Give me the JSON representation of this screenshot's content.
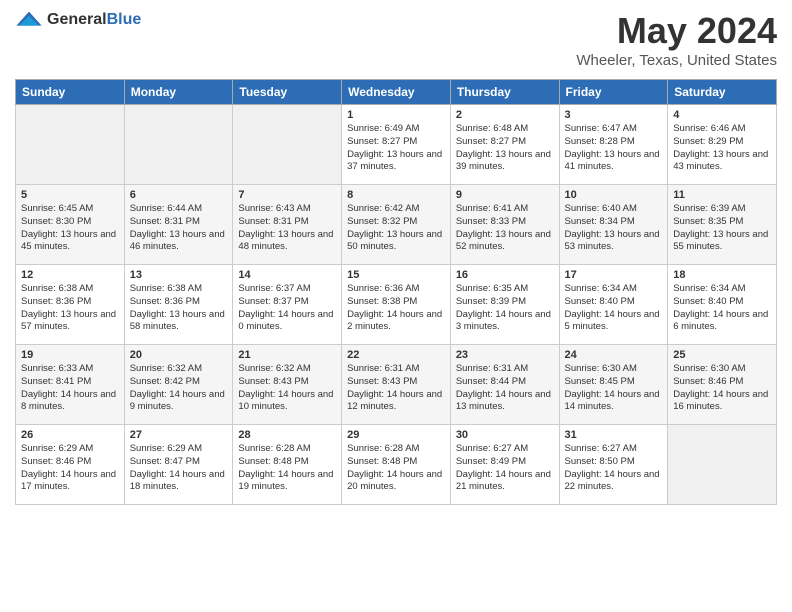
{
  "header": {
    "logo_general": "General",
    "logo_blue": "Blue",
    "month_year": "May 2024",
    "location": "Wheeler, Texas, United States"
  },
  "days_of_week": [
    "Sunday",
    "Monday",
    "Tuesday",
    "Wednesday",
    "Thursday",
    "Friday",
    "Saturday"
  ],
  "weeks": [
    [
      {
        "day": "",
        "info": ""
      },
      {
        "day": "",
        "info": ""
      },
      {
        "day": "",
        "info": ""
      },
      {
        "day": "1",
        "info": "Sunrise: 6:49 AM\nSunset: 8:27 PM\nDaylight: 13 hours and 37 minutes."
      },
      {
        "day": "2",
        "info": "Sunrise: 6:48 AM\nSunset: 8:27 PM\nDaylight: 13 hours and 39 minutes."
      },
      {
        "day": "3",
        "info": "Sunrise: 6:47 AM\nSunset: 8:28 PM\nDaylight: 13 hours and 41 minutes."
      },
      {
        "day": "4",
        "info": "Sunrise: 6:46 AM\nSunset: 8:29 PM\nDaylight: 13 hours and 43 minutes."
      }
    ],
    [
      {
        "day": "5",
        "info": "Sunrise: 6:45 AM\nSunset: 8:30 PM\nDaylight: 13 hours and 45 minutes."
      },
      {
        "day": "6",
        "info": "Sunrise: 6:44 AM\nSunset: 8:31 PM\nDaylight: 13 hours and 46 minutes."
      },
      {
        "day": "7",
        "info": "Sunrise: 6:43 AM\nSunset: 8:31 PM\nDaylight: 13 hours and 48 minutes."
      },
      {
        "day": "8",
        "info": "Sunrise: 6:42 AM\nSunset: 8:32 PM\nDaylight: 13 hours and 50 minutes."
      },
      {
        "day": "9",
        "info": "Sunrise: 6:41 AM\nSunset: 8:33 PM\nDaylight: 13 hours and 52 minutes."
      },
      {
        "day": "10",
        "info": "Sunrise: 6:40 AM\nSunset: 8:34 PM\nDaylight: 13 hours and 53 minutes."
      },
      {
        "day": "11",
        "info": "Sunrise: 6:39 AM\nSunset: 8:35 PM\nDaylight: 13 hours and 55 minutes."
      }
    ],
    [
      {
        "day": "12",
        "info": "Sunrise: 6:38 AM\nSunset: 8:36 PM\nDaylight: 13 hours and 57 minutes."
      },
      {
        "day": "13",
        "info": "Sunrise: 6:38 AM\nSunset: 8:36 PM\nDaylight: 13 hours and 58 minutes."
      },
      {
        "day": "14",
        "info": "Sunrise: 6:37 AM\nSunset: 8:37 PM\nDaylight: 14 hours and 0 minutes."
      },
      {
        "day": "15",
        "info": "Sunrise: 6:36 AM\nSunset: 8:38 PM\nDaylight: 14 hours and 2 minutes."
      },
      {
        "day": "16",
        "info": "Sunrise: 6:35 AM\nSunset: 8:39 PM\nDaylight: 14 hours and 3 minutes."
      },
      {
        "day": "17",
        "info": "Sunrise: 6:34 AM\nSunset: 8:40 PM\nDaylight: 14 hours and 5 minutes."
      },
      {
        "day": "18",
        "info": "Sunrise: 6:34 AM\nSunset: 8:40 PM\nDaylight: 14 hours and 6 minutes."
      }
    ],
    [
      {
        "day": "19",
        "info": "Sunrise: 6:33 AM\nSunset: 8:41 PM\nDaylight: 14 hours and 8 minutes."
      },
      {
        "day": "20",
        "info": "Sunrise: 6:32 AM\nSunset: 8:42 PM\nDaylight: 14 hours and 9 minutes."
      },
      {
        "day": "21",
        "info": "Sunrise: 6:32 AM\nSunset: 8:43 PM\nDaylight: 14 hours and 10 minutes."
      },
      {
        "day": "22",
        "info": "Sunrise: 6:31 AM\nSunset: 8:43 PM\nDaylight: 14 hours and 12 minutes."
      },
      {
        "day": "23",
        "info": "Sunrise: 6:31 AM\nSunset: 8:44 PM\nDaylight: 14 hours and 13 minutes."
      },
      {
        "day": "24",
        "info": "Sunrise: 6:30 AM\nSunset: 8:45 PM\nDaylight: 14 hours and 14 minutes."
      },
      {
        "day": "25",
        "info": "Sunrise: 6:30 AM\nSunset: 8:46 PM\nDaylight: 14 hours and 16 minutes."
      }
    ],
    [
      {
        "day": "26",
        "info": "Sunrise: 6:29 AM\nSunset: 8:46 PM\nDaylight: 14 hours and 17 minutes."
      },
      {
        "day": "27",
        "info": "Sunrise: 6:29 AM\nSunset: 8:47 PM\nDaylight: 14 hours and 18 minutes."
      },
      {
        "day": "28",
        "info": "Sunrise: 6:28 AM\nSunset: 8:48 PM\nDaylight: 14 hours and 19 minutes."
      },
      {
        "day": "29",
        "info": "Sunrise: 6:28 AM\nSunset: 8:48 PM\nDaylight: 14 hours and 20 minutes."
      },
      {
        "day": "30",
        "info": "Sunrise: 6:27 AM\nSunset: 8:49 PM\nDaylight: 14 hours and 21 minutes."
      },
      {
        "day": "31",
        "info": "Sunrise: 6:27 AM\nSunset: 8:50 PM\nDaylight: 14 hours and 22 minutes."
      },
      {
        "day": "",
        "info": ""
      }
    ]
  ]
}
